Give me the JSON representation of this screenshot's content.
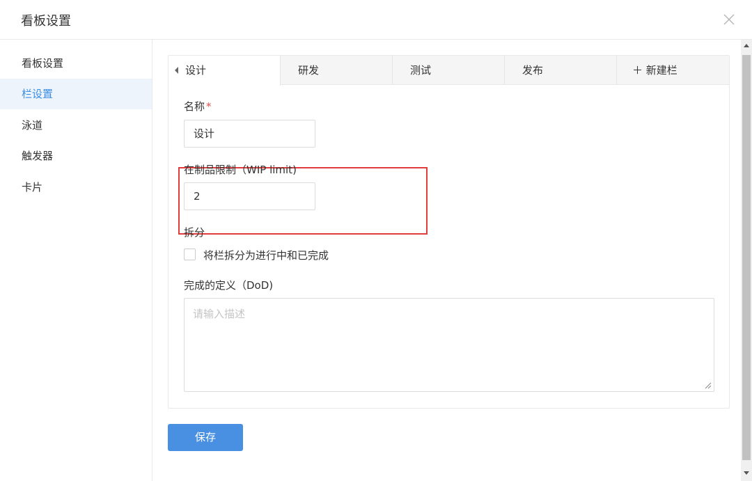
{
  "dialog": {
    "title": "看板设置",
    "close_icon": "close-icon"
  },
  "sidebar": {
    "items": [
      {
        "label": "看板设置",
        "active": false
      },
      {
        "label": "栏设置",
        "active": true
      },
      {
        "label": "泳道",
        "active": false
      },
      {
        "label": "触发器",
        "active": false
      },
      {
        "label": "卡片",
        "active": false
      }
    ]
  },
  "tabs": [
    {
      "label": "设计",
      "active": true
    },
    {
      "label": "研发",
      "active": false
    },
    {
      "label": "测试",
      "active": false
    },
    {
      "label": "发布",
      "active": false
    },
    {
      "label": "＋ 新建栏",
      "active": false
    }
  ],
  "form": {
    "name_label": "名称",
    "required_mark": "*",
    "name_value": "设计",
    "wip_label": "在制品限制（WIP limit)",
    "wip_value": "2",
    "split_label": "拆分",
    "split_checkbox_label": "将栏拆分为进行中和已完成",
    "split_checked": false,
    "dod_label": "完成的定义（DoD)",
    "dod_placeholder": "请输入描述"
  },
  "actions": {
    "save_label": "保存"
  },
  "colors": {
    "accent": "#4a90e2",
    "active_nav_bg": "#eef4fc",
    "highlight_border": "#e23b3b",
    "required": "#e64c4c"
  }
}
